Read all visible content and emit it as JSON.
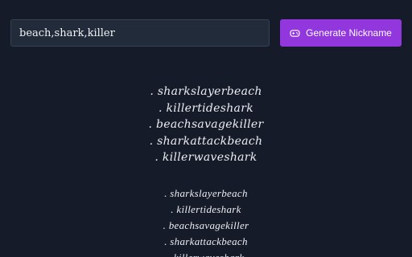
{
  "search": {
    "value": "beach,shark,killer"
  },
  "generate_button": {
    "label": "Generate Nickname",
    "icon": "gamepad-icon"
  },
  "results": {
    "group_a": [
      ". sharkslayerbeach",
      ". killertideshark",
      ". beachsavagekiller",
      ". sharkattackbeach",
      ". killerwaveshark"
    ],
    "group_b": [
      ". sharkslayerbeach",
      ". killertideshark",
      ". beachsavagekiller",
      ". sharkattackbeach",
      ". killerwaveshark"
    ]
  },
  "colors": {
    "background": "#161b29",
    "input_background": "#222b3a",
    "button": "#9236de",
    "text": "#eceef3"
  }
}
